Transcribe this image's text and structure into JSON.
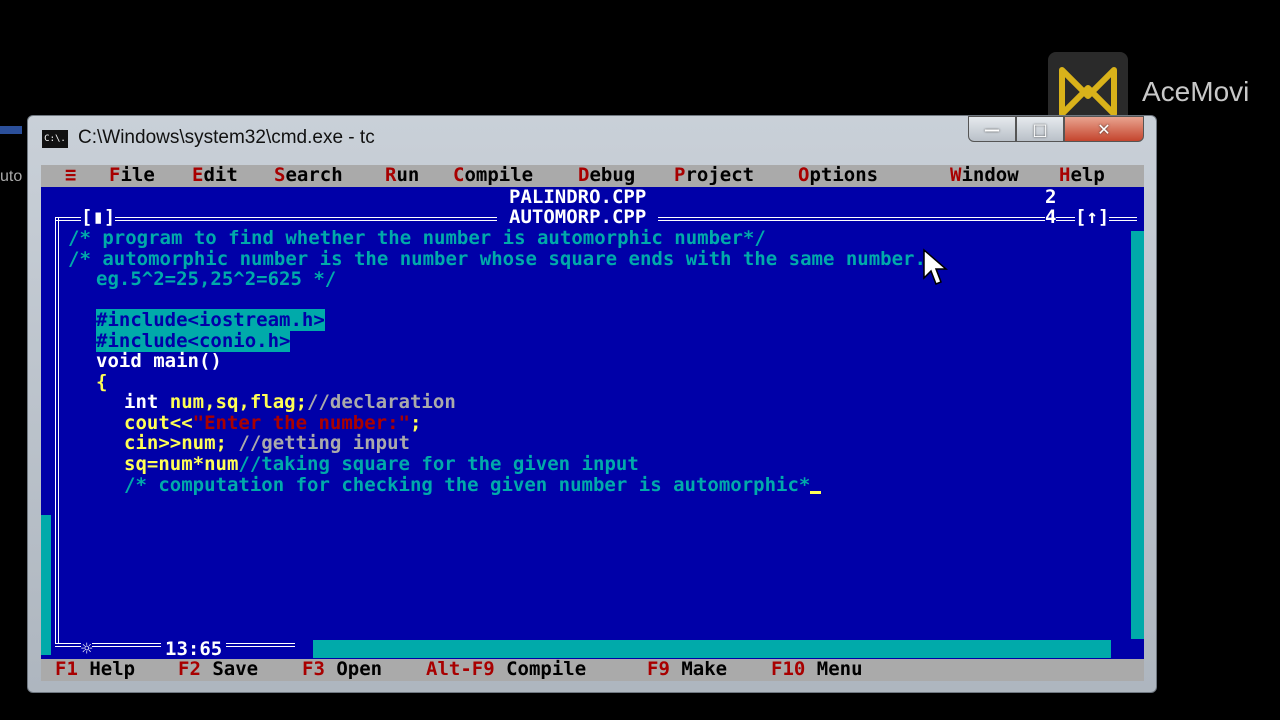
{
  "desktop": {
    "edge_label": "uto",
    "watermark": "AceMovi"
  },
  "window": {
    "title": "C:\\Windows\\system32\\cmd.exe - tc",
    "icon_text": "C:\\.",
    "minimize": "—",
    "maximize": "□",
    "close": "✕"
  },
  "menubar": {
    "system": "≡",
    "items": [
      {
        "hk": "F",
        "rest": "ile"
      },
      {
        "hk": "E",
        "rest": "dit"
      },
      {
        "hk": "S",
        "rest": "earch"
      },
      {
        "hk": "R",
        "rest": "un"
      },
      {
        "hk": "C",
        "rest": "ompile"
      },
      {
        "hk": "D",
        "rest": "ebug"
      },
      {
        "hk": "P",
        "rest": "roject"
      },
      {
        "hk": "O",
        "rest": "ptions"
      },
      {
        "hk": "W",
        "rest": "indow"
      },
      {
        "hk": "H",
        "rest": "elp"
      }
    ]
  },
  "editor": {
    "back_file": "PALINDRO.CPP",
    "back_num": "2",
    "file": "AUTOMORP.CPP",
    "close_box": "[▮]",
    "window_num": "4",
    "zoom_box": "[↑]",
    "position": "13:65",
    "star": "☼",
    "code": {
      "l1": "/* program to find whether the number is automorphic number*/",
      "l2": "/* automorphic number is the number whose square ends with the same number.",
      "l3": "eg.5^2=25,25^2=625 */",
      "inc1": "#include<iostream.h>",
      "inc2": "#include<conio.h>",
      "main": "void main()",
      "brace": "{",
      "decl_kw": "int ",
      "decl_vars": "num,sq,flag;",
      "decl_cmt": "//declaration",
      "cout_kw": "cout<<",
      "cout_str": "\"Enter the number:\"",
      "cout_end": ";",
      "cin_kw": "cin>>num; ",
      "cin_cmt": "//getting input",
      "sq_code": "sq=num*num",
      "sq_cmt": "//taking square for the given input",
      "comp_cmt": "/* computation for checking the given number is automorphic*"
    }
  },
  "statusbar": [
    {
      "key": "F1",
      "label": " Help"
    },
    {
      "key": "F2",
      "label": " Save"
    },
    {
      "key": "F3",
      "label": " Open"
    },
    {
      "key": "Alt-F9",
      "label": " Compile"
    },
    {
      "key": "F9",
      "label": " Make"
    },
    {
      "key": "F10",
      "label": " Menu"
    }
  ],
  "colors": {
    "dos_blue": "#0000a8",
    "menu_gray": "#aaaaaa",
    "hotkey_red": "#a80000",
    "comment_cyan": "#00aaaa",
    "keyword_yellow": "#ffff55"
  }
}
